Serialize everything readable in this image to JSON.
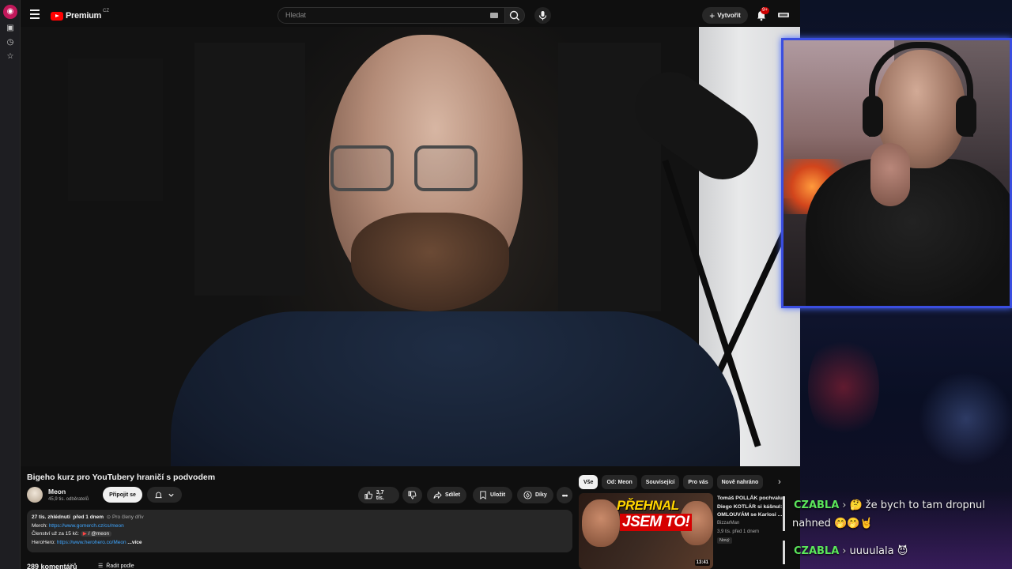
{
  "browser": {
    "badge_icon": "app-icon"
  },
  "masthead": {
    "logo_text": "Premium",
    "country": "CZ",
    "search_placeholder": "Hledat",
    "create_label": "Vytvořit",
    "notif_count": "9+"
  },
  "video": {
    "title": "Bigeho kurz pro YouTubery hraničí s podvodem",
    "channel": "Meon",
    "subscribers": "45,9 tis. odběratelů",
    "join_label": "Připojit se",
    "likes": "3,7 tis.",
    "share_label": "Sdílet",
    "save_label": "Uložit",
    "thanks_label": "Díky"
  },
  "description": {
    "views": "27 tis. zhlédnutí",
    "date": "před 1 dnem",
    "members_note": "Pro členy dřív",
    "merch_label": "Merch:",
    "merch_url": "https://www.gomerch.cz/cs/meon",
    "membership_label": "Členství už za 15 kč:",
    "membership_handle": "/ @meon",
    "herohero_label": "HeroHero:",
    "herohero_url": "https://www.herohero.co/Meon",
    "more_label": "...více"
  },
  "comments": {
    "count_label": "289 komentářů",
    "sort_label": "Řadit podle"
  },
  "chips": [
    "Vše",
    "Od: Meon",
    "Související",
    "Pro vás",
    "Nově nahráno"
  ],
  "recommendation": {
    "thumb_line1": "PŘEHNAL",
    "thumb_line2": "JSEM TO!",
    "duration": "13:41",
    "title": "Tomáš POLLÁK pochvalu, Diego KOTLÁR si kášnul: OMLOUVÁM se Karlosi ...",
    "channel": "BizzarMan",
    "meta": "3,9 tis.   před 1 dnem",
    "new_badge": "Nový"
  },
  "chat": [
    {
      "user": "CZABLA",
      "text": "🤔 že bych to tam dropnul",
      "text2": "nahned 🤭🤭🤘"
    },
    {
      "user": "CZABLA",
      "text": "uuuulala 😈"
    }
  ],
  "colors": {
    "accent": "#ff0000",
    "link": "#3ea6ff",
    "chat_user": "#5be65b",
    "cam_border": "#3a4ee0"
  }
}
